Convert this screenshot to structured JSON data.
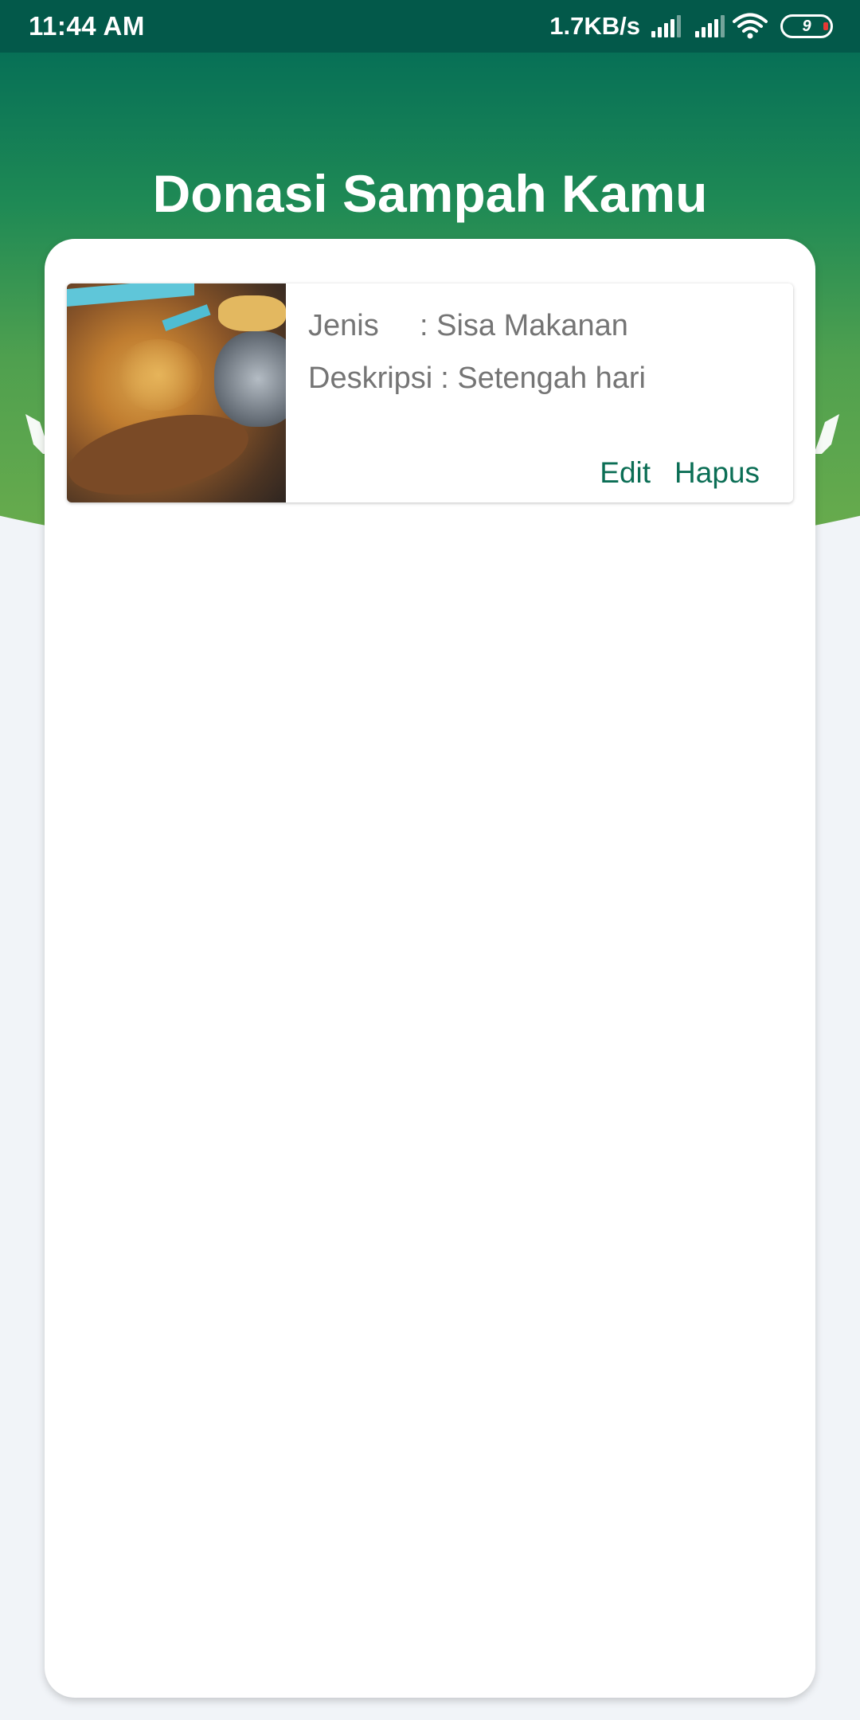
{
  "status_bar": {
    "time": "11:44 AM",
    "net_speed": "1.7KB/s",
    "battery_level": "9",
    "icons": [
      "signal-icon",
      "signal-icon",
      "wifi-icon",
      "battery-icon"
    ]
  },
  "header": {
    "title": "Donasi Sampah Kamu",
    "icons": [
      "hand-icon",
      "hand-icon"
    ]
  },
  "donations": [
    {
      "type_label": "Jenis",
      "type_value": ": Sisa Makanan",
      "description_label": "Deskripsi",
      "description_value": ": Setengah hari",
      "edit_label": "Edit",
      "delete_label": "Hapus"
    }
  ],
  "colors": {
    "status_bar": "#03594a",
    "header_top": "#077056",
    "header_bottom": "#6cad4c",
    "accent": "#0b6e55",
    "text_secondary": "#757575",
    "background": "#f1f4f8"
  }
}
